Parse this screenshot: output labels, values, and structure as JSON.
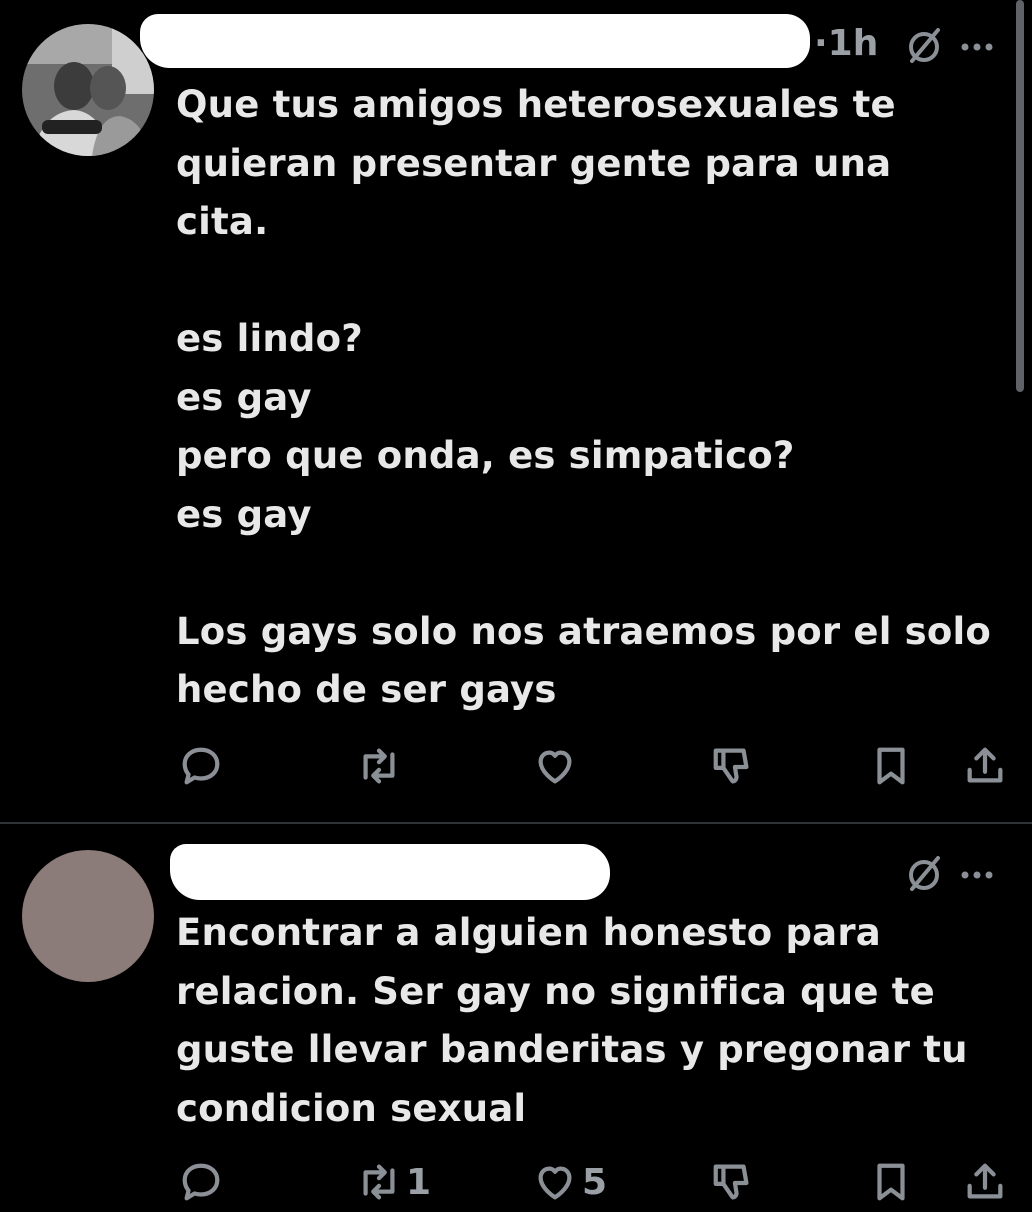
{
  "tweets": [
    {
      "time": "·1h",
      "text": "Que tus amigos heterosexuales te\nquieran presentar gente para una\ncita.\n\nes lindo?\nes gay\npero que onda, es simpatico?\nes gay\n\nLos gays solo nos atraemos por el solo\nhecho de ser gays",
      "actions": {
        "reply": "",
        "retweet": "",
        "like": "",
        "dislike": ""
      }
    },
    {
      "time": "",
      "text": "Encontrar a alguien honesto para\nrelacion. Ser gay no significa que te\nguste llevar banderitas y pregonar tu\ncondicion sexual",
      "actions": {
        "reply": "",
        "retweet": "1",
        "like": "5",
        "dislike": ""
      }
    }
  ],
  "colors": {
    "background": "#000000",
    "text": "#e7e9ea",
    "muted": "#8b9096",
    "divider": "#2f3336"
  },
  "icons": [
    "reply-icon",
    "retweet-icon",
    "like-icon",
    "dislike-icon",
    "bookmark-icon",
    "share-icon",
    "grok-icon",
    "more-icon"
  ]
}
